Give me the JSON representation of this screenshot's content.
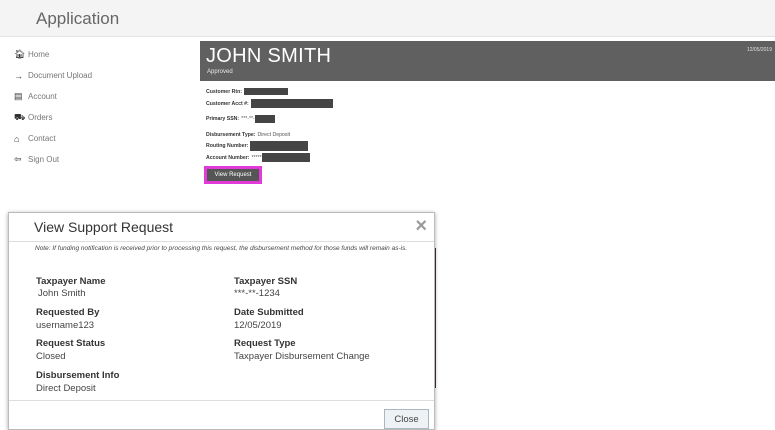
{
  "app": {
    "title": "Application"
  },
  "sidebar": {
    "items": [
      {
        "label": "Home",
        "icon": "home-icon",
        "glyph": "🏠︎"
      },
      {
        "label": "Document Upload",
        "icon": "arrow-right-icon",
        "glyph": "→"
      },
      {
        "label": "Account",
        "icon": "account-icon",
        "glyph": "▤"
      },
      {
        "label": "Orders",
        "icon": "cart-icon",
        "glyph": "⛟"
      },
      {
        "label": "Contact",
        "icon": "contact-icon",
        "glyph": "⌂"
      },
      {
        "label": "Sign Out",
        "icon": "sign-out-icon",
        "glyph": "⇦"
      }
    ]
  },
  "customer": {
    "name": "JOHN SMITH",
    "status": "Approved",
    "date": "12/05/2019",
    "rtn_label": "Customer Rtn:",
    "acct_label": "Customer Acct #:",
    "ssn_label": "Primary SSN:",
    "ssn_value": "***-**-",
    "disbursement_label": "Disbursement Type:",
    "disbursement_value": "Direct Deposit",
    "routing_label": "Routing Number:",
    "account_label": "Account Number:",
    "account_value": "*****",
    "view_button": "View Request"
  },
  "modal": {
    "title": "View Support Request",
    "close_icon": "×",
    "note": "Note: If funding notification is received prior to processing this request, the disbursement method for those funds will remain as-is.",
    "fields": {
      "taxpayer_name": {
        "label": "Taxpayer Name",
        "value": "John Smith"
      },
      "taxpayer_ssn": {
        "label": "Taxpayer SSN",
        "value": "***-**-1234"
      },
      "requested_by": {
        "label": "Requested By",
        "value": "username123"
      },
      "date_submitted": {
        "label": "Date Submitted",
        "value": "12/05/2019"
      },
      "request_status": {
        "label": "Request Status",
        "value": "Closed"
      },
      "request_type": {
        "label": "Request Type",
        "value": "Taxpayer Disbursement Change"
      },
      "disbursement_info": {
        "label": "Disbursement Info",
        "value": "Direct Deposit"
      }
    },
    "close_button": "Close"
  },
  "colors": {
    "highlight": "#e23ad8",
    "header": "#606060",
    "redaction": "#454545"
  }
}
